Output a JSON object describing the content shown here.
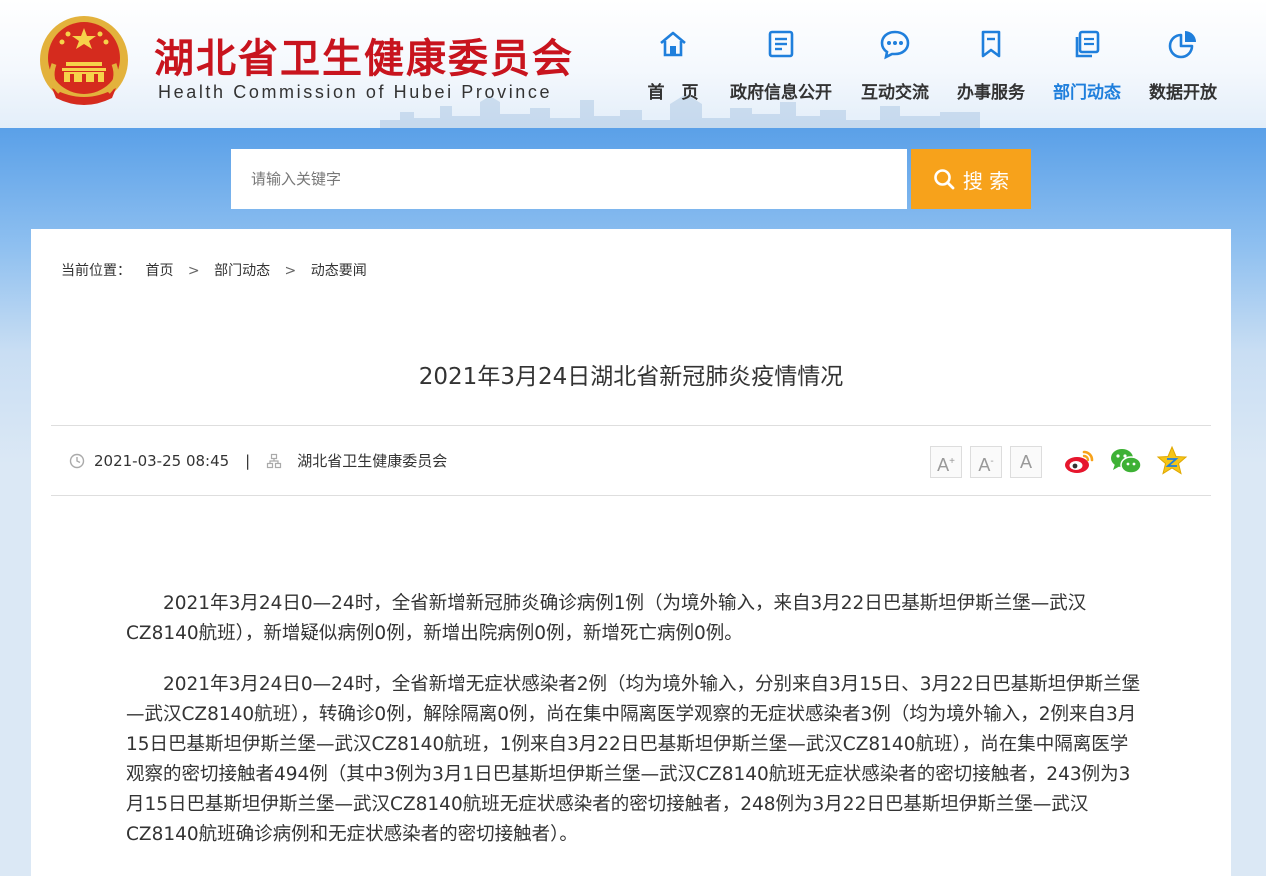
{
  "header": {
    "title": "湖北省卫生健康委员会",
    "subtitle": "Health Commission of Hubei Province",
    "nav": [
      {
        "label": "首　页",
        "icon": "home-icon"
      },
      {
        "label": "政府信息公开",
        "icon": "document-list-icon"
      },
      {
        "label": "互动交流",
        "icon": "chat-bubble-icon"
      },
      {
        "label": "办事服务",
        "icon": "bookmark-icon"
      },
      {
        "label": "部门动态",
        "icon": "copy-pages-icon",
        "active": true
      },
      {
        "label": "数据开放",
        "icon": "pie-chart-icon"
      }
    ]
  },
  "search": {
    "placeholder": "请输入关键字",
    "button_label": "搜 索"
  },
  "breadcrumb": {
    "prefix": "当前位置：",
    "items": [
      "首页",
      "部门动态",
      "动态要闻"
    ],
    "separator": ">"
  },
  "article": {
    "title": "2021年3月24日湖北省新冠肺炎疫情情况",
    "datetime": "2021-03-25 08:45",
    "source": "湖北省卫生健康委员会",
    "paragraphs": [
      "2021年3月24日0—24时，全省新增新冠肺炎确诊病例1例（为境外输入，来自3月22日巴基斯坦伊斯兰堡—武汉CZ8140航班），新增疑似病例0例，新增出院病例0例，新增死亡病例0例。",
      "2021年3月24日0—24时，全省新增无症状感染者2例（均为境外输入，分别来自3月15日、3月22日巴基斯坦伊斯兰堡—武汉CZ8140航班），转确诊0例，解除隔离0例，尚在集中隔离医学观察的无症状感染者3例（均为境外输入，2例来自3月15日巴基斯坦伊斯兰堡—武汉CZ8140航班，1例来自3月22日巴基斯坦伊斯兰堡—武汉CZ8140航班），尚在集中隔离医学观察的密切接触者494例（其中3例为3月1日巴基斯坦伊斯兰堡—武汉CZ8140航班无症状感染者的密切接触者，243例为3月15日巴基斯坦伊斯兰堡—武汉CZ8140航班无症状感染者的密切接触者，248例为3月22日巴基斯坦伊斯兰堡—武汉CZ8140航班确诊病例和无症状感染者的密切接触者）。"
    ]
  },
  "font_controls": [
    "A+",
    "A-",
    "A"
  ],
  "share": [
    "weibo-icon",
    "wechat-icon",
    "favorite-star-icon"
  ],
  "colors": {
    "brand_red": "#c8141e",
    "accent_blue": "#1f7fdc",
    "search_orange": "#f7a21b"
  }
}
